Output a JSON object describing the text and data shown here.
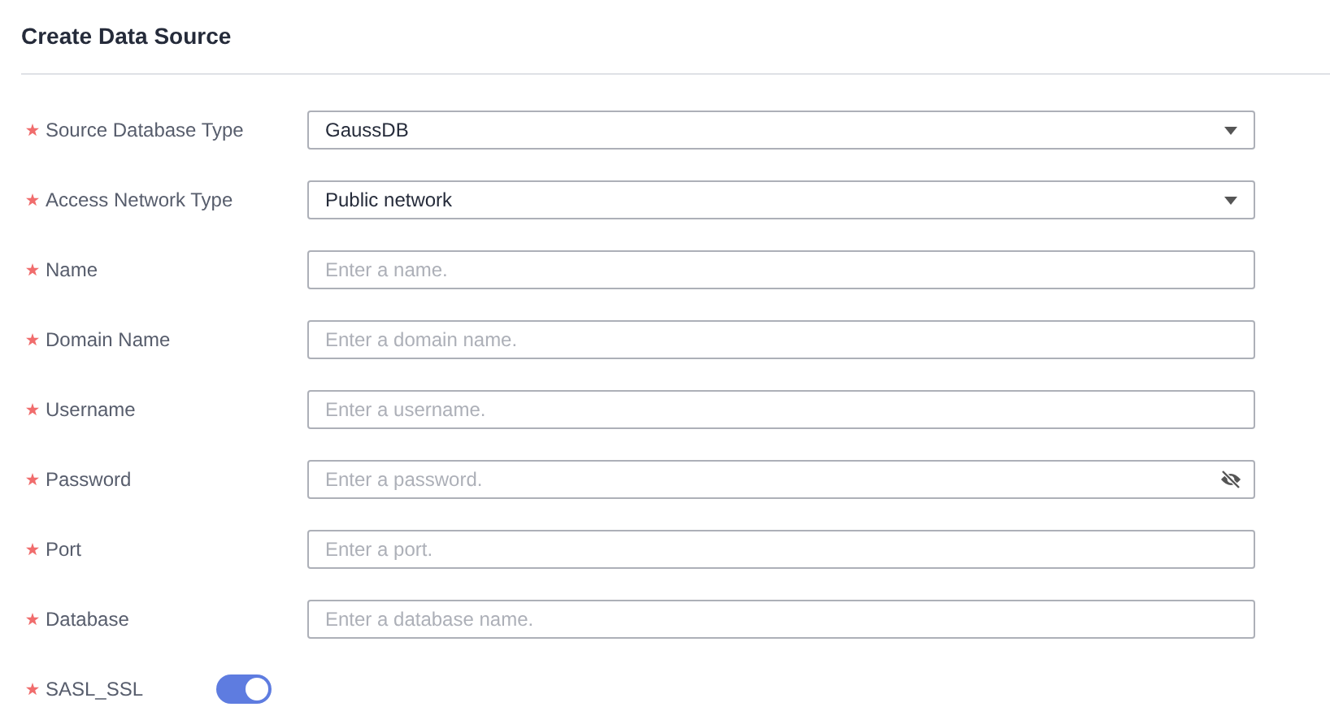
{
  "title": "Create Data Source",
  "fields": [
    {
      "kind": "select",
      "label": "Source Database Type",
      "required": true,
      "value": "GaussDB"
    },
    {
      "kind": "select",
      "label": "Access Network Type",
      "required": true,
      "value": "Public network"
    },
    {
      "kind": "text",
      "label": "Name",
      "required": true,
      "placeholder": "Enter a name."
    },
    {
      "kind": "text",
      "label": "Domain Name",
      "required": true,
      "placeholder": "Enter a domain name."
    },
    {
      "kind": "text",
      "label": "Username",
      "required": true,
      "placeholder": "Enter a username."
    },
    {
      "kind": "password",
      "label": "Password",
      "required": true,
      "placeholder": "Enter a password."
    },
    {
      "kind": "text",
      "label": "Port",
      "required": true,
      "placeholder": "Enter a port."
    },
    {
      "kind": "text",
      "label": "Database",
      "required": true,
      "placeholder": "Enter a database name."
    },
    {
      "kind": "switch",
      "label": "SASL_SSL",
      "required": true,
      "on": true
    }
  ]
}
